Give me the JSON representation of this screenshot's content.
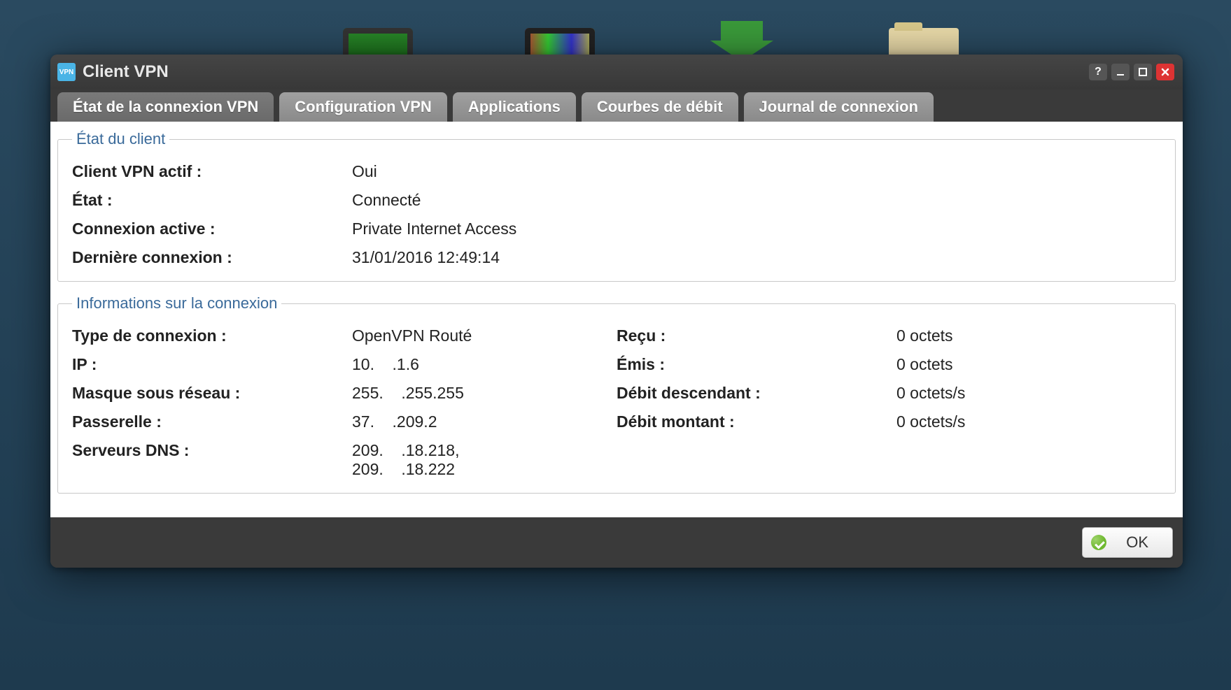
{
  "window": {
    "title": "Client VPN",
    "app_icon_text": "VPN"
  },
  "tabs": [
    {
      "label": "État de la connexion VPN",
      "active": true
    },
    {
      "label": "Configuration VPN",
      "active": false
    },
    {
      "label": "Applications",
      "active": false
    },
    {
      "label": "Courbes de débit",
      "active": false
    },
    {
      "label": "Journal de connexion",
      "active": false
    }
  ],
  "client_status": {
    "legend": "État du client",
    "rows": [
      {
        "label": "Client VPN actif :",
        "value": "Oui"
      },
      {
        "label": "État :",
        "value": "Connecté"
      },
      {
        "label": "Connexion active :",
        "value": "Private Internet Access"
      },
      {
        "label": "Dernière connexion :",
        "value": "31/01/2016 12:49:14"
      }
    ]
  },
  "connection_info": {
    "legend": "Informations sur la connexion",
    "left": [
      {
        "label": "Type de connexion :",
        "value": "OpenVPN Routé"
      },
      {
        "label": "IP :",
        "value": "10.    .1.6"
      },
      {
        "label": "Masque sous réseau :",
        "value": "255.    .255.255"
      },
      {
        "label": "Passerelle :",
        "value": "37.    .209.2"
      },
      {
        "label": "Serveurs DNS :",
        "value": "209.    .18.218,\n209.    .18.222"
      }
    ],
    "right": [
      {
        "label": "Reçu :",
        "value": "0 octets"
      },
      {
        "label": "Émis :",
        "value": "0 octets"
      },
      {
        "label": "Débit descendant :",
        "value": "0 octets/s"
      },
      {
        "label": "Débit montant :",
        "value": "0 octets/s"
      }
    ]
  },
  "footer": {
    "ok_label": "OK"
  }
}
